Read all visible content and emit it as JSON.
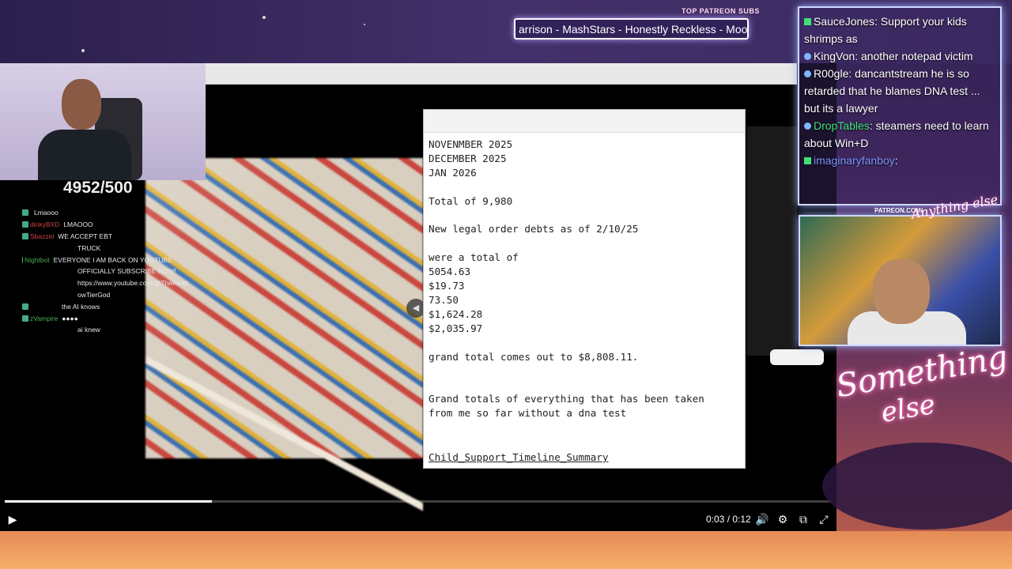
{
  "overlay": {
    "patreon_label": "TOP PATREON SUBS",
    "ticker_text": "arrison - MashStars - Honestly Reckless - Moot"
  },
  "left_stream": {
    "sub_counter": "4952/500",
    "chat": [
      {
        "user": "",
        "msg": "Lmaooo",
        "user_color": "#cc4444"
      },
      {
        "user": "dinkyBXD",
        "msg": "LMAOOO",
        "user_color": "#cc4444"
      },
      {
        "user": "Sbazzel",
        "msg": "WE ACCEPT EBT",
        "user_color": "#cc4444"
      },
      {
        "user": "",
        "msg": "TRUCK",
        "user_color": "#cccccc"
      },
      {
        "user": "Nightbot",
        "msg": "EVERYONE I AM BACK ON YOUTUBE",
        "user_color": "#4caf50"
      },
      {
        "user": "",
        "msg": "OFFICIALLY SUBSCRIBE NOW!",
        "user_color": "#cccccc"
      },
      {
        "user": "",
        "msg": "https://www.youtube.com/@TheRealt",
        "user_color": "#cccccc"
      },
      {
        "user": "",
        "msg": "owTierGod",
        "user_color": "#cccccc"
      },
      {
        "user": "",
        "msg": "the AI knows",
        "user_color": "#d256c8"
      },
      {
        "user": "zVampire",
        "msg": "",
        "user_color": "#4caf50"
      },
      {
        "user": "",
        "msg": "ai knew",
        "user_color": "#cccccc"
      }
    ]
  },
  "notepad": {
    "text": "NOVENMBER 2025\nDECEMBER 2025\nJAN 2026\n\nTotal of 9,980\n\nNew legal order debts as of 2/10/25\n\nwere a total of\n5054.63\n$19.73\n73.50\n$1,624.28\n$2,035.97\n\ngrand total comes out to $8,808.11.\n\n\nGrand totals of everything that has been taken\nfrom me so far without a dna test",
    "filename": "Child_Support_Timeline_Summary"
  },
  "player": {
    "current_time": "0:03",
    "duration": "0:12",
    "timecode": "0:03 / 0:12",
    "progress_fraction": 0.25,
    "icons": {
      "play": "play-icon",
      "volume": "volume-icon",
      "settings": "gear-icon",
      "miniplayer": "miniplayer-icon",
      "fullscreen": "exit-fullscreen-icon"
    }
  },
  "right_chat": {
    "messages": [
      {
        "user": "SauceJones",
        "msg": "Support your kids shrimps as",
        "badge": "green",
        "user_color": "#ffffff"
      },
      {
        "user": "KingVon",
        "msg": "another notepad victim",
        "badge": "blue",
        "user_color": "#ffffff"
      },
      {
        "user": "R00gle",
        "msg": "dancantstream he is so retarded that he blames DNA test ... but its a lawyer",
        "badge": "blue",
        "user_color": "#ffffff"
      },
      {
        "user": "DropTables",
        "msg": "steamers need to learn about Win+D",
        "badge": "blue",
        "user_color": "#3ee077"
      },
      {
        "user": "imaginaryfanboy",
        "msg": "",
        "badge": "green",
        "user_color": "#7d95ff"
      }
    ]
  },
  "branding": {
    "patreon_url": "PATREON.COM/",
    "logo_small": "Anything else",
    "logo_big_line1": "Something",
    "logo_big_line2": "else"
  }
}
